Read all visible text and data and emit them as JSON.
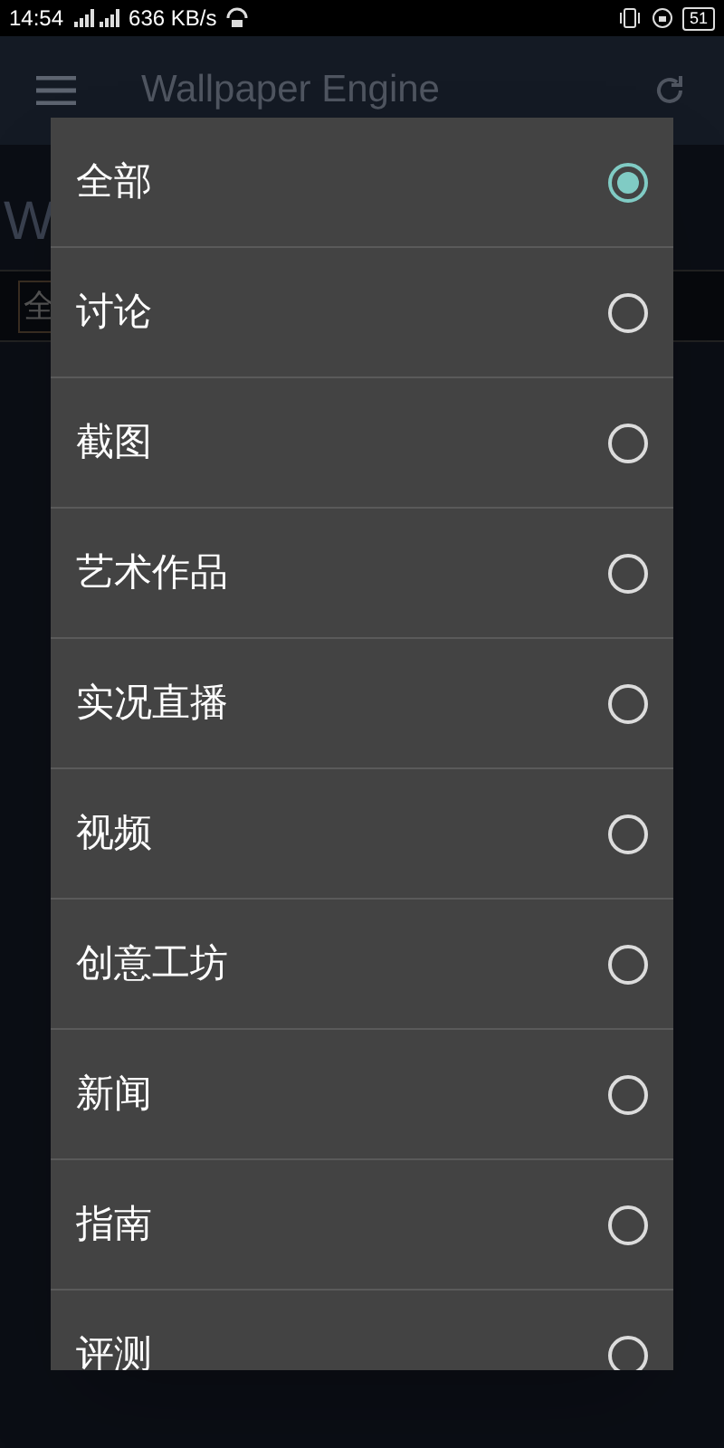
{
  "status_bar": {
    "time": "14:54",
    "speed": "636 KB/s",
    "battery": "51"
  },
  "app_bar": {
    "title": "Wallpaper Engine"
  },
  "background": {
    "heading_fragment": "W",
    "filter_fragment": "全"
  },
  "dialog": {
    "options": [
      {
        "label": "全部",
        "selected": true
      },
      {
        "label": "讨论",
        "selected": false
      },
      {
        "label": "截图",
        "selected": false
      },
      {
        "label": "艺术作品",
        "selected": false
      },
      {
        "label": "实况直播",
        "selected": false
      },
      {
        "label": "视频",
        "selected": false
      },
      {
        "label": "创意工坊",
        "selected": false
      },
      {
        "label": "新闻",
        "selected": false
      },
      {
        "label": "指南",
        "selected": false
      },
      {
        "label": "评测",
        "selected": false
      }
    ]
  }
}
